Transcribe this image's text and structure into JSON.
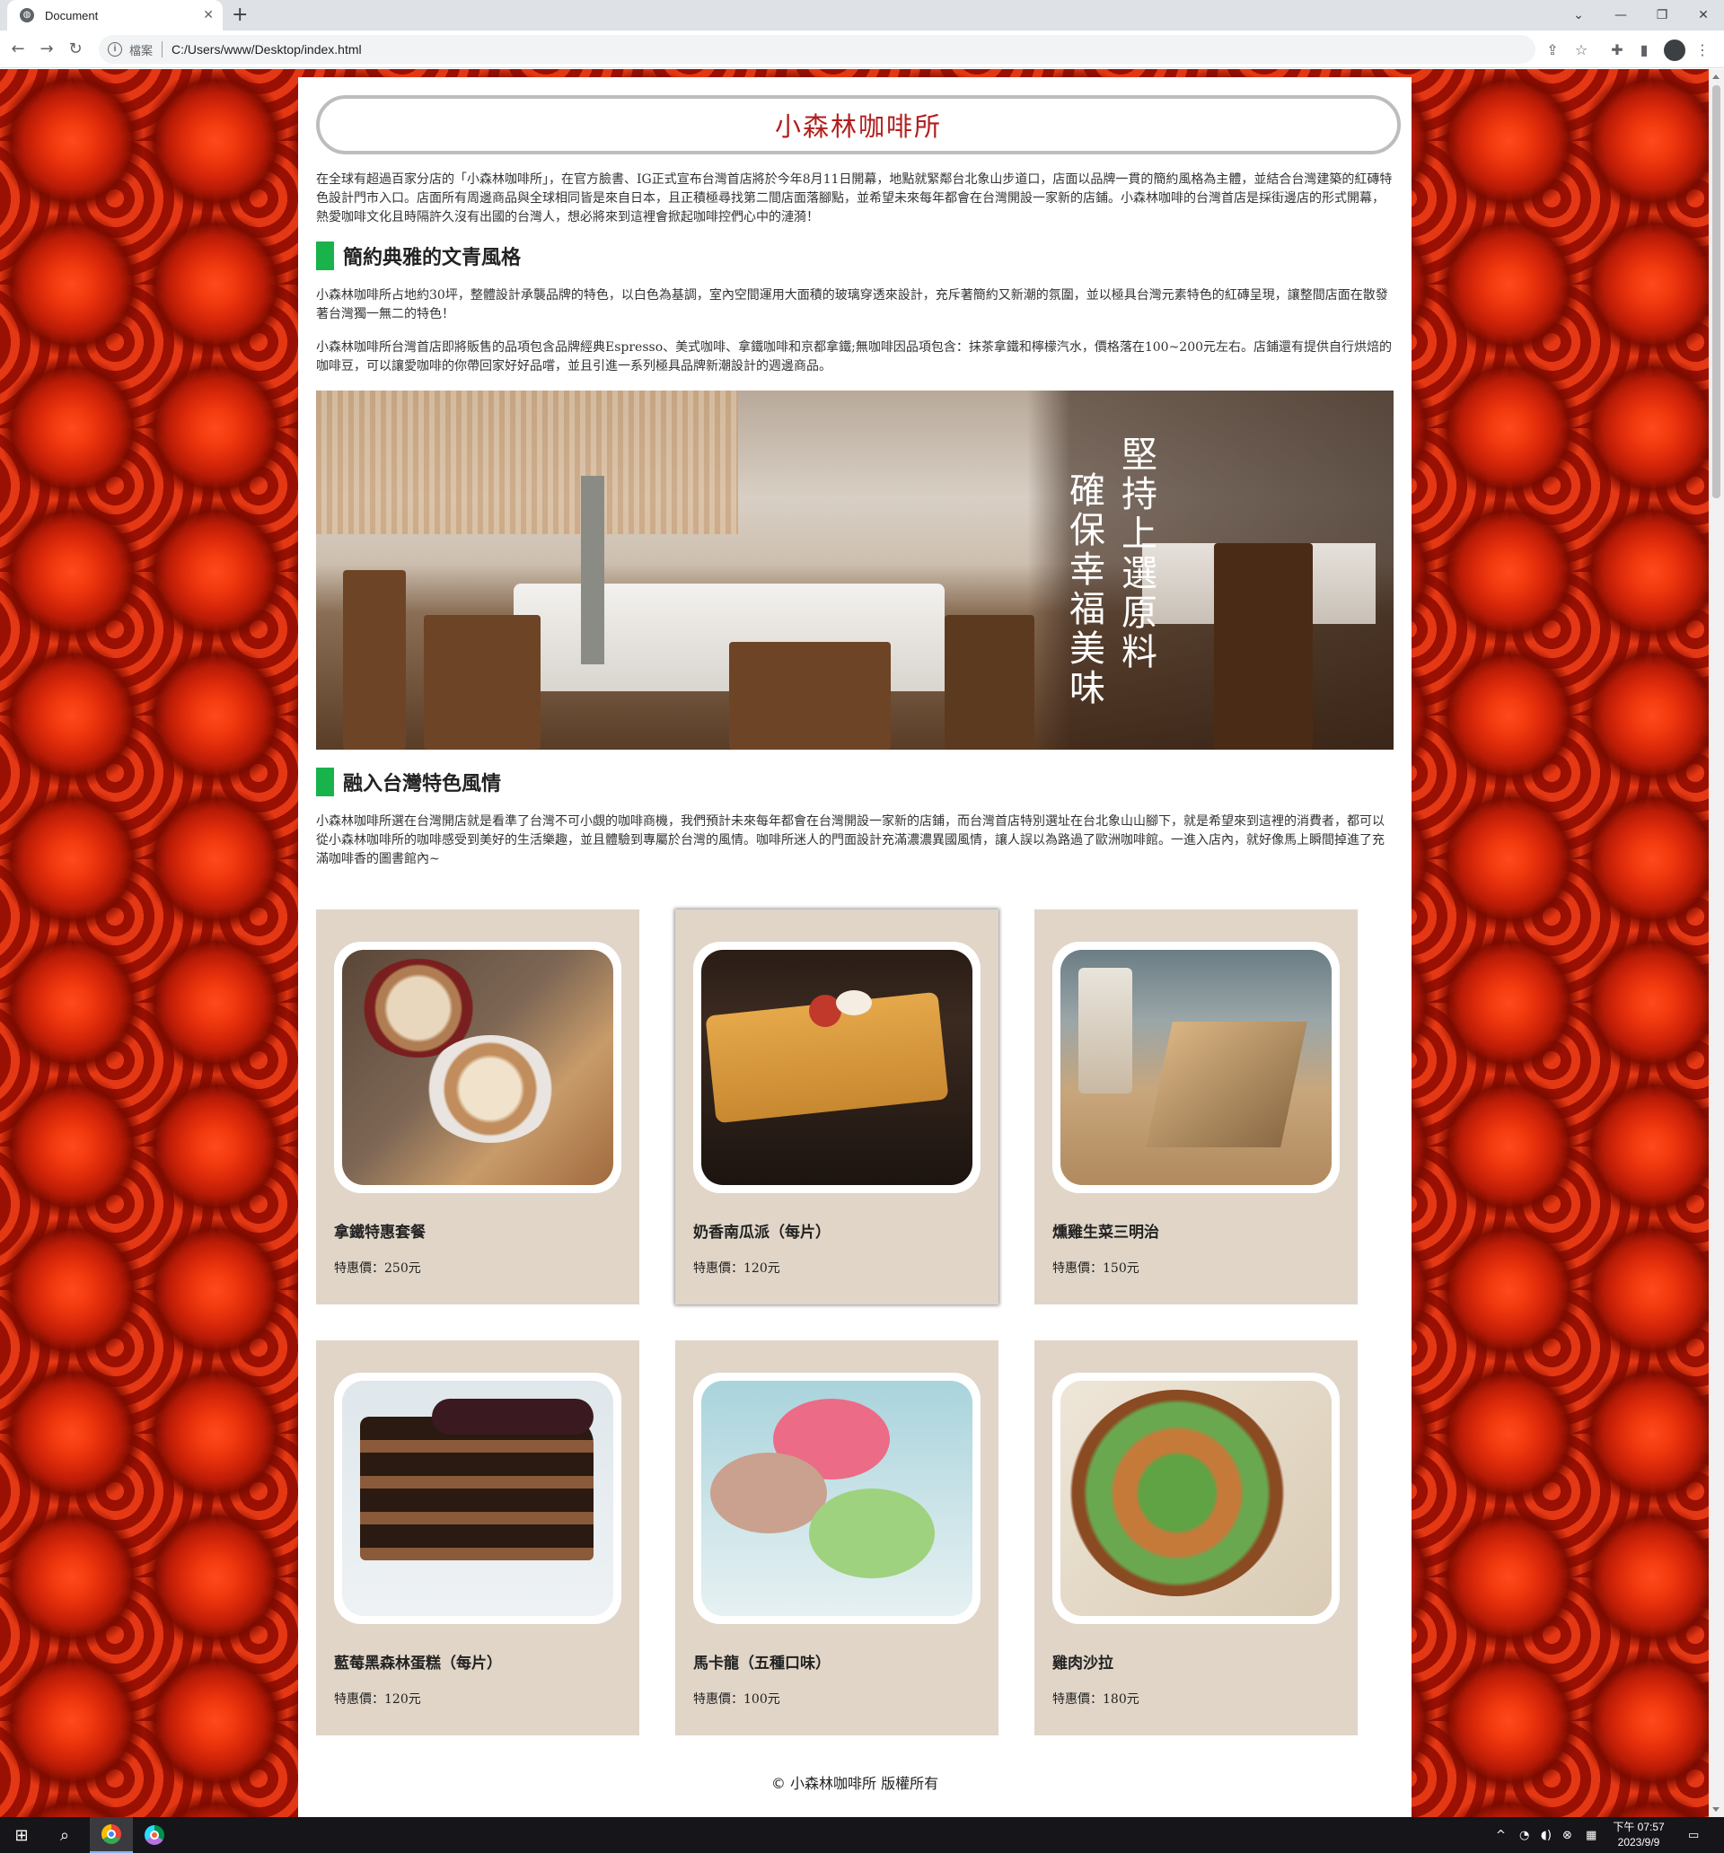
{
  "browser": {
    "tab_title": "Document",
    "new_tab": "+",
    "address_scheme": "檔案",
    "address_url": "C:/Users/www/Desktop/index.html"
  },
  "page": {
    "site_title": "小森林咖啡所",
    "intro": "在全球有超過百家分店的「小森林咖啡所」，在官方臉書、IG正式宣布台灣首店將於今年8月11日開幕，地點就緊鄰台北象山步道口，店面以品牌一貫的簡約風格為主體，並結合台灣建築的紅磚特色設計門市入口。店面所有周邊商品與全球相同皆是來自日本，且正積極尋找第二間店面落腳點，並希望未來每年都會在台灣開設一家新的店鋪。小森林咖啡的台灣首店是採街邊店的形式開幕，熱愛咖啡文化且時隔許久沒有出國的台灣人，想必將來到這裡會掀起咖啡控們心中的漣漪！",
    "section1": {
      "heading": "簡約典雅的文青風格",
      "p1": "小森林咖啡所占地約30坪，整體設計承襲品牌的特色，以白色為基調，室內空間運用大面積的玻璃穿透來設計，充斥著簡約又新潮的氛圍，並以極具台灣元素特色的紅磚呈現，讓整間店面在散發著台灣獨一無二的特色！",
      "p2": "小森林咖啡所台灣首店即將販售的品項包含品牌經典Espresso、美式咖啡、拿鐵咖啡和京都拿鐵;無咖啡因品項包含：抹茶拿鐵和檸檬汽水，價格落在100~200元左右。店鋪還有提供自行烘焙的咖啡豆，可以讓愛咖啡的你帶回家好好品嚐，並且引進一系列極具品牌新潮設計的週邊商品。"
    },
    "banner": {
      "line1": "堅持上選原料",
      "line2": "確保幸福美味"
    },
    "section2": {
      "heading": "融入台灣特色風情",
      "p1": "小森林咖啡所選在台灣開店就是看準了台灣不可小覷的咖啡商機，我們預計未來每年都會在台灣開設一家新的店鋪，而台灣首店特別選址在台北象山山腳下，就是希望來到這裡的消費者，都可以從小森林咖啡所的咖啡感受到美好的生活樂趣，並且體驗到專屬於台灣的風情。咖啡所迷人的門面設計充滿濃濃異國風情，讓人誤以為路過了歐洲咖啡館。一進入店內，就好像馬上瞬間掉進了充滿咖啡香的圖書館內~"
    },
    "products": [
      {
        "name": "拿鐵特惠套餐",
        "price": "特惠價：250元",
        "icon": "latte-photo"
      },
      {
        "name": "奶香南瓜派（每片）",
        "price": "特惠價：120元",
        "icon": "pumpkin-pie-photo"
      },
      {
        "name": "燻雞生菜三明治",
        "price": "特惠價：150元",
        "icon": "sandwich-photo"
      },
      {
        "name": "藍莓黑森林蛋糕（每片）",
        "price": "特惠價：120元",
        "icon": "cake-photo"
      },
      {
        "name": "馬卡龍（五種口味）",
        "price": "特惠價：100元",
        "icon": "macaron-photo"
      },
      {
        "name": "雞肉沙拉",
        "price": "特惠價：180元",
        "icon": "salad-photo"
      }
    ],
    "footer": "© 小森林咖啡所 版權所有"
  },
  "taskbar": {
    "clock_time": "下午 07:57",
    "clock_date": "2023/9/9"
  },
  "colors": {
    "title_red": "#b21e1e",
    "heading_green": "#18b34a",
    "card_bg": "#e0d5c7",
    "page_bg": "#c41806"
  }
}
